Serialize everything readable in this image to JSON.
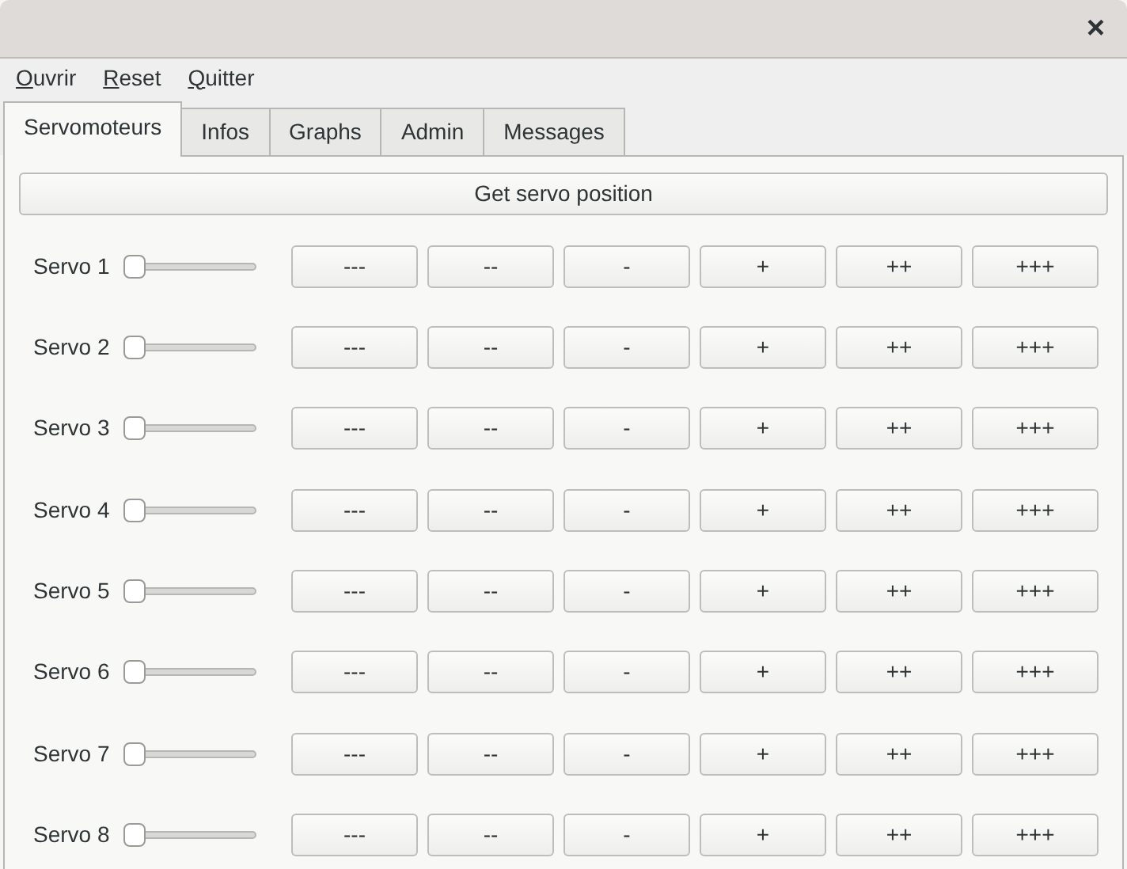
{
  "window": {
    "close": "×"
  },
  "menu": [
    {
      "label": "Ouvrir"
    },
    {
      "label": "Reset"
    },
    {
      "label": "Quitter"
    }
  ],
  "tabs": [
    {
      "label": "Servomoteurs",
      "selected": true
    },
    {
      "label": "Infos",
      "selected": false
    },
    {
      "label": "Graphs",
      "selected": false
    },
    {
      "label": "Admin",
      "selected": false
    },
    {
      "label": "Messages",
      "selected": false
    }
  ],
  "get_button": "Get servo position",
  "step_buttons": [
    "---",
    "--",
    "-",
    "+",
    "++",
    "+++"
  ],
  "servos": [
    {
      "name": "Servo 1",
      "level": 0
    },
    {
      "name": "Servo 2",
      "level": 0
    },
    {
      "name": "Servo 3",
      "level": 0
    },
    {
      "name": "Servo 4",
      "level": 0
    },
    {
      "name": "Servo 5",
      "level": 0
    },
    {
      "name": "Servo 6",
      "level": 0
    },
    {
      "name": "Servo 7",
      "level": 0
    },
    {
      "name": "Servo 8",
      "level": 0
    }
  ]
}
